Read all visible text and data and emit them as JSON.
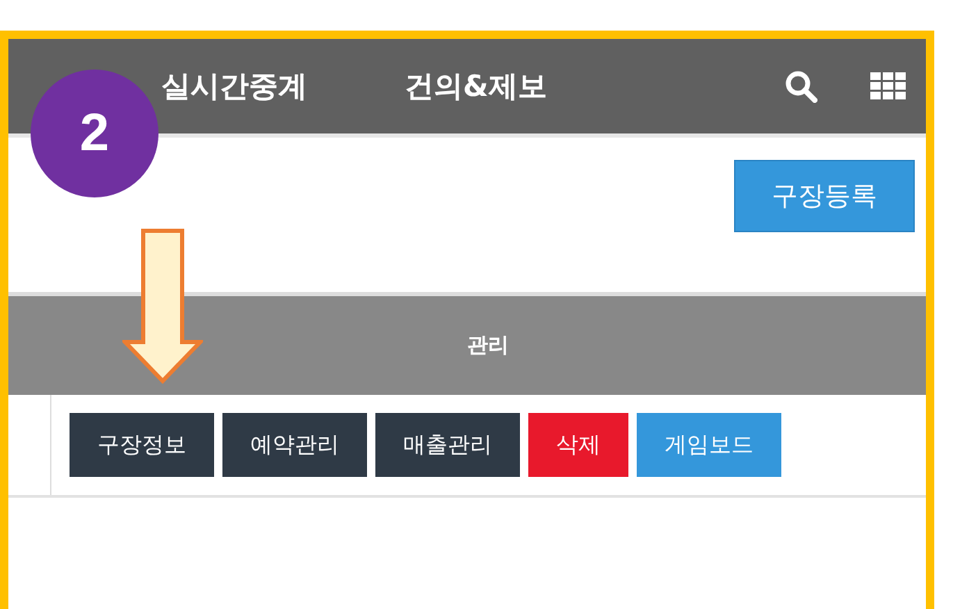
{
  "nav": {
    "items": [
      "실시간중계",
      "건의&제보"
    ]
  },
  "annotation": {
    "step": "2"
  },
  "register_button": "구장등록",
  "table": {
    "columns": [
      "관리"
    ],
    "rows": [
      {
        "actions": [
          {
            "label": "구장정보",
            "color": "#2f3a46"
          },
          {
            "label": "예약관리",
            "color": "#2f3a46"
          },
          {
            "label": "매출관리",
            "color": "#2f3a46"
          },
          {
            "label": "삭제",
            "color": "#e8192c"
          },
          {
            "label": "게임보드",
            "color": "#3497db"
          }
        ]
      }
    ]
  }
}
